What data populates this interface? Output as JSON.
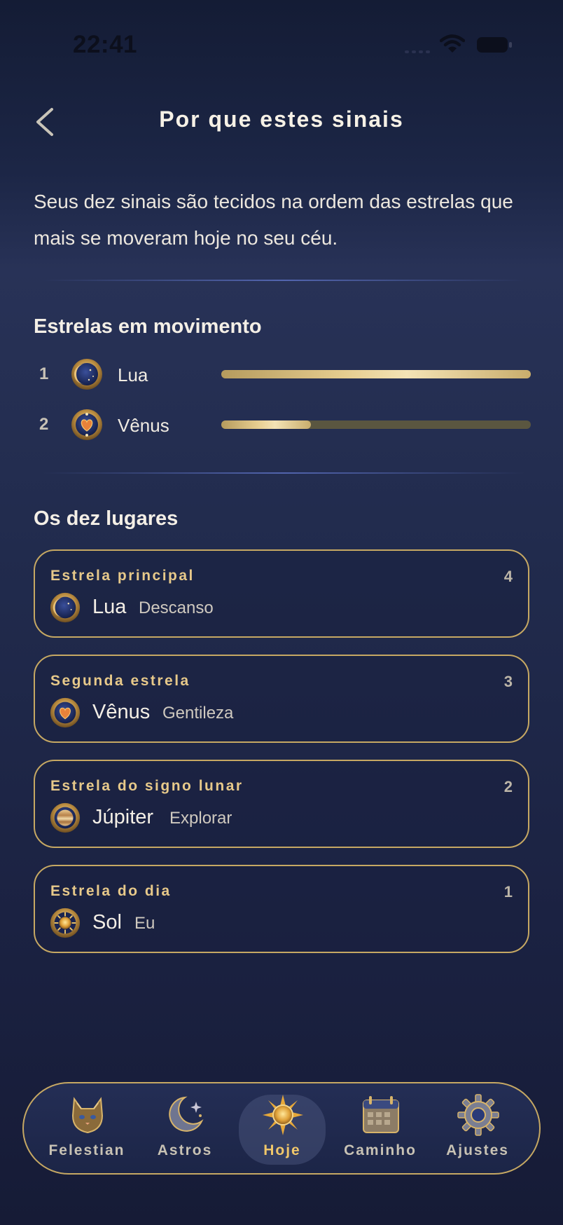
{
  "status_bar": {
    "time": "22:41"
  },
  "header": {
    "title": "Por que estes sinais"
  },
  "intro": {
    "text": "Seus dez sinais são tecidos na ordem das estrelas que mais se moveram hoje no seu céu."
  },
  "moving_stars": {
    "title": "Estrelas em movimento",
    "items": [
      {
        "rank": "1",
        "name": "Lua",
        "icon": "moon-icon",
        "level": 1.0
      },
      {
        "rank": "2",
        "name": "Vênus",
        "icon": "venus-icon",
        "level": 0.29
      }
    ]
  },
  "places": {
    "title": "Os dez lugares",
    "items": [
      {
        "label": "Estrela principal",
        "count": "4",
        "planet": "Lua",
        "meaning": "Descanso",
        "icon": "moon-icon"
      },
      {
        "label": "Segunda estrela",
        "count": "3",
        "planet": "Vênus",
        "meaning": "Gentileza",
        "icon": "venus-icon"
      },
      {
        "label": "Estrela do signo lunar",
        "count": "2",
        "planet": "Júpiter",
        "meaning": "Explorar",
        "icon": "jupiter-icon"
      },
      {
        "label": "Estrela do dia",
        "count": "1",
        "planet": "Sol",
        "meaning": "Eu",
        "icon": "sun-icon"
      }
    ]
  },
  "tab_bar": {
    "active": "Hoje",
    "tabs": [
      {
        "label": "Felestian",
        "icon": "cat-icon"
      },
      {
        "label": "Astros",
        "icon": "crescent-moon-icon"
      },
      {
        "label": "Hoje",
        "icon": "sun-icon"
      },
      {
        "label": "Caminho",
        "icon": "calendar-icon"
      },
      {
        "label": "Ajustes",
        "icon": "gear-icon"
      }
    ]
  },
  "colors": {
    "accent_gold": "#c6a863",
    "label_gold": "#e7c98a",
    "active_tab": "#f0c76a",
    "background": "#1c2646"
  }
}
